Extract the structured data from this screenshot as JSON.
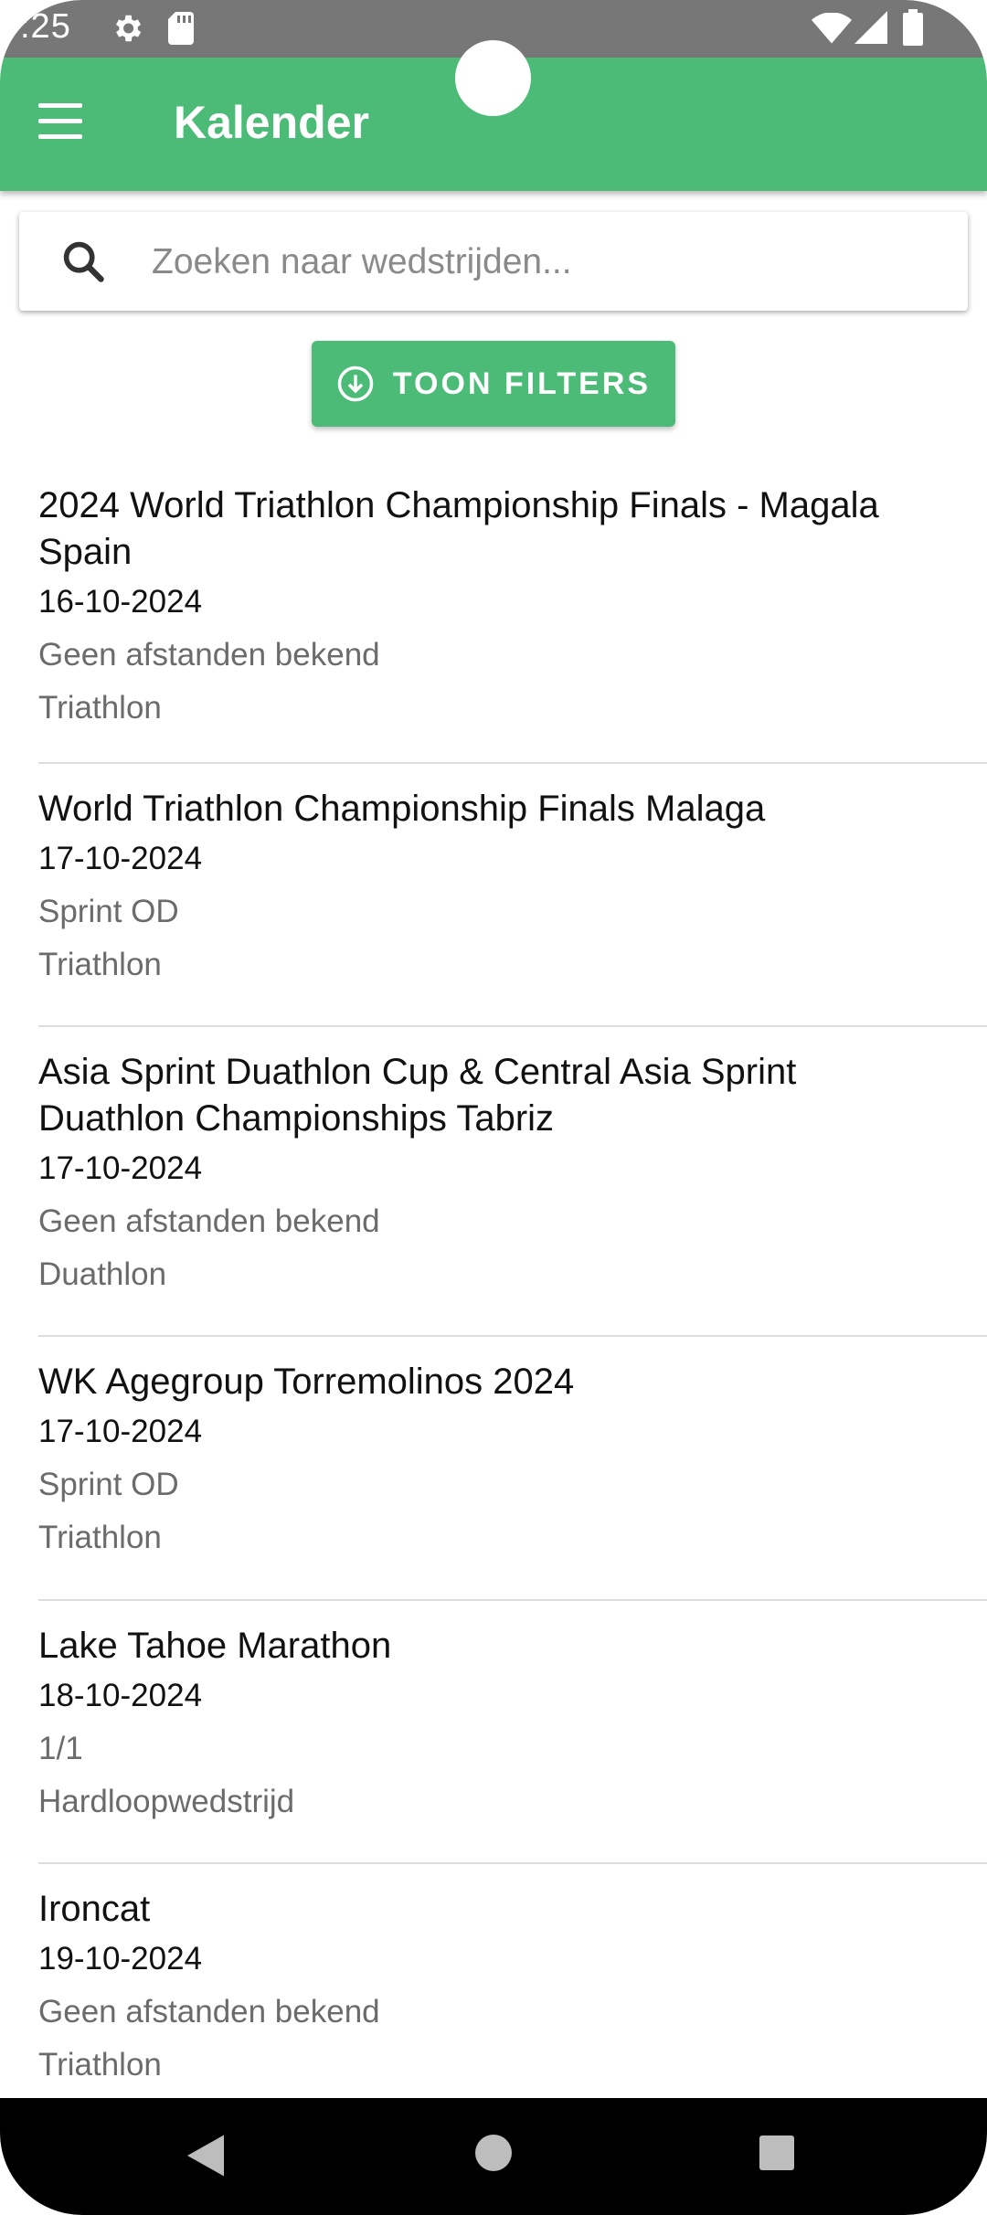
{
  "status_bar": {
    "time": ":25",
    "icons": [
      "gear-icon",
      "sd-card-icon",
      "wifi-icon",
      "signal-icon",
      "battery-icon"
    ]
  },
  "app_bar": {
    "title": "Kalender",
    "menu_icon": "hamburger-menu-icon",
    "color": "#4cbb78"
  },
  "search": {
    "placeholder": "Zoeken naar wedstrijden...",
    "value": "",
    "icon": "search-icon"
  },
  "filter_button": {
    "label": "TOON FILTERS",
    "icon": "arrow-down-circle-icon"
  },
  "events": [
    {
      "title": "2024 World Triathlon Championship Finals - Magala Spain",
      "date": "16-10-2024",
      "distance": "Geen afstanden bekend",
      "sport": "Triathlon"
    },
    {
      "title": "World Triathlon Championship Finals Malaga",
      "date": "17-10-2024",
      "distance": "Sprint OD",
      "sport": "Triathlon"
    },
    {
      "title": "Asia Sprint Duathlon Cup & Central Asia Sprint Duathlon Championships Tabriz",
      "date": "17-10-2024",
      "distance": "Geen afstanden bekend",
      "sport": "Duathlon"
    },
    {
      "title": "WK Agegroup Torremolinos 2024",
      "date": "17-10-2024",
      "distance": "Sprint OD",
      "sport": "Triathlon"
    },
    {
      "title": "Lake Tahoe Marathon",
      "date": "18-10-2024",
      "distance": "1/1",
      "sport": "Hardloopwedstrijd"
    },
    {
      "title": "Ironcat",
      "date": "19-10-2024",
      "distance": "Geen afstanden bekend",
      "sport": "Triathlon"
    }
  ],
  "nav_bar": {
    "icons": [
      "back-icon",
      "home-icon",
      "recents-icon"
    ]
  }
}
